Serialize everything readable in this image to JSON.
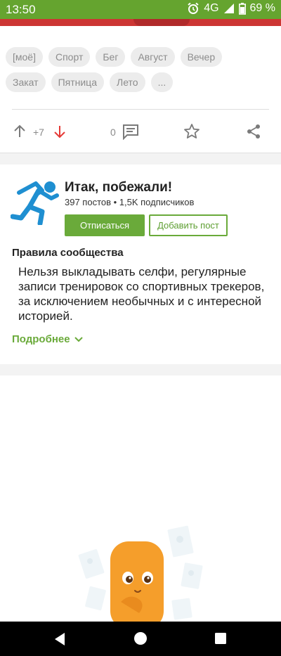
{
  "status_bar": {
    "time": "13:50",
    "network": "4G",
    "battery": "69 %",
    "icons": [
      "alarm-icon",
      "signal-icon",
      "battery-icon"
    ]
  },
  "post": {
    "tags": [
      "[моё]",
      "Спорт",
      "Бег",
      "Август",
      "Вечер",
      "Закат",
      "Пятница",
      "Лето",
      "..."
    ],
    "rating": "+7",
    "comments_count": "0",
    "icons": [
      "upvote-icon",
      "downvote-icon",
      "comment-icon",
      "star-icon",
      "share-icon"
    ]
  },
  "community": {
    "title": "Итак, побежали!",
    "stats": "397 постов • 1,5K подписчиков",
    "unsubscribe_label": "Отписаться",
    "add_post_label": "Добавить пост",
    "rules_title": "Правила сообщества",
    "rules_text": "Нельзя выкладывать селфи, регулярные записи тренировок со спортивных трекеров, за исключением необычных и с интересной историей.",
    "more_label": "Подробнее"
  },
  "colors": {
    "accent": "#65a42f",
    "logo_blue": "#1f8fd1",
    "downvote": "#e53935"
  }
}
